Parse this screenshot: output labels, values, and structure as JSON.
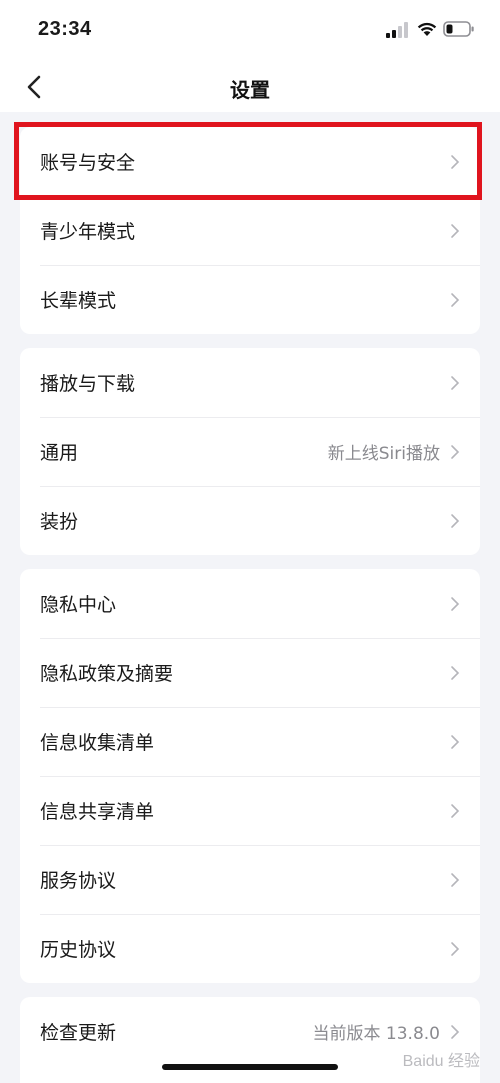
{
  "status_bar": {
    "time": "23:34"
  },
  "nav": {
    "title": "设置"
  },
  "groups": [
    {
      "items": [
        {
          "label": "账号与安全"
        },
        {
          "label": "青少年模式"
        },
        {
          "label": "长辈模式"
        }
      ]
    },
    {
      "items": [
        {
          "label": "播放与下载"
        },
        {
          "label": "通用",
          "value": "新上线Siri播放"
        },
        {
          "label": "装扮"
        }
      ]
    },
    {
      "items": [
        {
          "label": "隐私中心"
        },
        {
          "label": "隐私政策及摘要"
        },
        {
          "label": "信息收集清单"
        },
        {
          "label": "信息共享清单"
        },
        {
          "label": "服务协议"
        },
        {
          "label": "历史协议"
        }
      ]
    },
    {
      "items": [
        {
          "label": "检查更新",
          "value": "当前版本 13.8.0"
        }
      ]
    }
  ],
  "watermark": "Baidu 经验",
  "colors": {
    "highlight": "#e0141e",
    "background": "#f3f4f8"
  }
}
